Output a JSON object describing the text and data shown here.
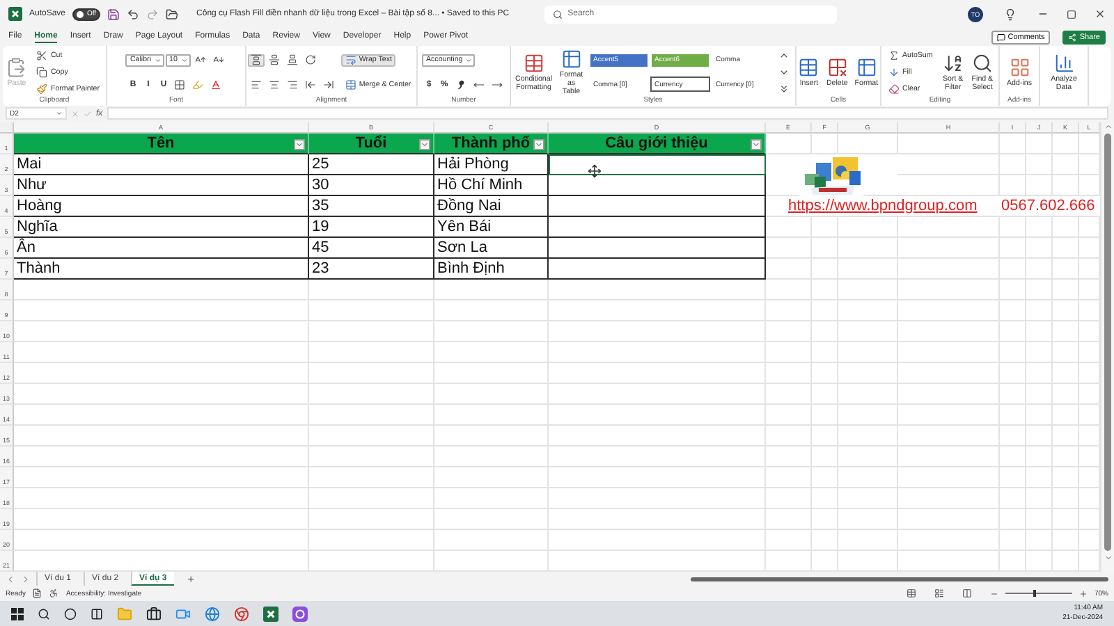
{
  "title_bar": {
    "autosave_label": "AutoSave",
    "autosave_state": "Off",
    "autosave_on": false,
    "title": "Công cụ Flash Fill điền nhanh dữ liệu trong Excel – Bài tập số 8...  •  Saved to this PC",
    "search_placeholder": "Search",
    "avatar": "TO"
  },
  "menu_tabs": [
    {
      "label": "File",
      "selected": false
    },
    {
      "label": "Home",
      "selected": true
    },
    {
      "label": "Insert",
      "selected": false
    },
    {
      "label": "Draw",
      "selected": false
    },
    {
      "label": "Page Layout",
      "selected": false
    },
    {
      "label": "Formulas",
      "selected": false
    },
    {
      "label": "Data",
      "selected": false
    },
    {
      "label": "Review",
      "selected": false
    },
    {
      "label": "View",
      "selected": false
    },
    {
      "label": "Developer",
      "selected": false
    },
    {
      "label": "Help",
      "selected": false
    },
    {
      "label": "Power Pivot",
      "selected": false
    }
  ],
  "comments": "Comments",
  "share": "Share",
  "ribbon": {
    "groups": [
      {
        "label": "Clipboard",
        "columns": [
          [
            [
              {
                "kind": "large",
                "label": "Paste",
                "disabled": true
              }
            ]
          ],
          [
            [
              {
                "kind": "small",
                "label": "Cut"
              }
            ],
            [
              {
                "kind": "small",
                "label": "Copy"
              }
            ],
            [
              {
                "kind": "small",
                "label": "Format Painter"
              }
            ]
          ]
        ]
      },
      {
        "label": "Font",
        "columns": [
          [
            [
              {
                "kind": "combo",
                "label": "Calibri"
              },
              {
                "kind": "combo",
                "label": "10"
              },
              {
                "kind": "tool"
              },
              {
                "kind": "tool"
              }
            ],
            [
              {
                "kind": "tool",
                "label": "B"
              },
              {
                "kind": "tool",
                "label": "I"
              },
              {
                "kind": "tool",
                "label": "U"
              },
              {
                "kind": "tool"
              },
              {
                "kind": "tool"
              },
              {
                "kind": "tool"
              }
            ]
          ]
        ]
      },
      {
        "label": "Alignment",
        "columns": [
          [
            [
              {
                "kind": "tool",
                "on": true
              },
              {
                "kind": "tool",
                "on": false
              },
              {
                "kind": "tool",
                "on": false
              },
              {
                "kind": "tool",
                "on": false
              }
            ],
            [
              {
                "kind": "tool",
                "on": false
              },
              {
                "kind": "tool",
                "on": false
              },
              {
                "kind": "tool",
                "on": false
              },
              {
                "kind": "tool",
                "on": false
              },
              {
                "kind": "tool",
                "on": false
              }
            ]
          ],
          [
            [
              {
                "kind": "small",
                "label": "Wrap Text",
                "on": true
              }
            ],
            [
              {
                "kind": "small",
                "label": "Merge & Center",
                "on": false
              }
            ]
          ]
        ]
      },
      {
        "label": "Number",
        "columns": [
          [
            [
              {
                "kind": "combo",
                "label": "Accounting"
              }
            ],
            [
              {
                "kind": "tool",
                "label": "$"
              },
              {
                "kind": "tool",
                "label": "%"
              },
              {
                "kind": "tool"
              },
              {
                "kind": "tool"
              },
              {
                "kind": "tool"
              }
            ]
          ]
        ]
      },
      {
        "label": "Styles",
        "columns": [
          [
            [
              {
                "kind": "large",
                "label": "Conditional Formatting"
              }
            ]
          ],
          [
            [
              {
                "kind": "large",
                "label": "Format as Table"
              }
            ]
          ],
          [
            [
              {
                "kind": "style",
                "label": "Accent5",
                "color": "#4472c4",
                "selected": false
              },
              {
                "kind": "style",
                "label": "Accent6",
                "color": "#70ad47",
                "selected": false
              },
              {
                "kind": "style",
                "label": "Comma",
                "selected": false
              }
            ],
            [
              {
                "kind": "style",
                "label": "Comma [0]",
                "selected": false
              },
              {
                "kind": "style",
                "label": "Currency",
                "selected": true
              },
              {
                "kind": "style",
                "label": "Currency [0]",
                "selected": false
              }
            ]
          ],
          [
            [
              {
                "kind": "tool"
              }
            ],
            [
              {
                "kind": "tool"
              }
            ],
            [
              {
                "kind": "tool"
              }
            ]
          ]
        ]
      },
      {
        "label": "Cells",
        "columns": [
          [
            [
              {
                "kind": "large",
                "label": "Insert"
              }
            ]
          ],
          [
            [
              {
                "kind": "large",
                "label": "Delete"
              }
            ]
          ],
          [
            [
              {
                "kind": "large",
                "label": "Format"
              }
            ]
          ]
        ]
      },
      {
        "label": "Editing",
        "columns": [
          [
            [
              {
                "kind": "small",
                "label": "AutoSum"
              }
            ],
            [
              {
                "kind": "small",
                "label": "Fill"
              }
            ],
            [
              {
                "kind": "small",
                "label": "Clear"
              }
            ]
          ],
          [
            [
              {
                "kind": "large",
                "label": "Sort & Filter"
              }
            ]
          ],
          [
            [
              {
                "kind": "large",
                "label": "Find & Select"
              }
            ]
          ]
        ]
      },
      {
        "label": "Add-ins",
        "columns": [
          [
            [
              {
                "kind": "large",
                "label": "Add-ins"
              }
            ]
          ]
        ]
      },
      {
        "columns": [
          [
            [
              {
                "kind": "large",
                "label": "Analyze Data"
              }
            ]
          ]
        ]
      }
    ]
  },
  "formula_bar": {
    "name_box": "D2",
    "fx": "fx"
  },
  "columns": [
    "A",
    "B",
    "C",
    "D",
    "E",
    "F",
    "G",
    "H",
    "I",
    "J",
    "K",
    "L"
  ],
  "row_numbers": [
    "1",
    "2",
    "3",
    "4",
    "5",
    "6",
    "7",
    "8",
    "9",
    "10",
    "11",
    "12",
    "13",
    "14",
    "15",
    "16",
    "17",
    "18",
    "19",
    "20",
    "21"
  ],
  "table": {
    "header": [
      "Tên",
      "Tuổi",
      "Thành phố",
      "Câu giới thiệu"
    ],
    "rows": [
      {
        "cells": [
          "Mai",
          "25",
          "Hải Phòng"
        ],
        "selected": true
      },
      {
        "cells": [
          "Như",
          "30",
          "Hồ Chí Minh"
        ],
        "selected": false
      },
      {
        "cells": [
          "Hoàng",
          "35",
          "Đồng Nai"
        ],
        "selected": false
      },
      {
        "cells": [
          "Nghĩa",
          "19",
          "Yên Bái"
        ],
        "selected": false
      },
      {
        "cells": [
          "Ân",
          "45",
          "Sơn La"
        ],
        "selected": false
      },
      {
        "cells": [
          "Thành",
          "23",
          "Bình Định"
        ],
        "selected": false
      }
    ]
  },
  "link": "https://www.bpndgroup.com",
  "phone": "0567.602.666",
  "sheet_tabs": [
    {
      "label": "Ví du 1",
      "selected": false
    },
    {
      "label": "Ví du 2",
      "selected": false
    },
    {
      "label": "Ví dụ 3",
      "selected": true
    }
  ],
  "add_sheet": "+",
  "status_bar": {
    "ready": "Ready",
    "accessibility": "Accessibility: Investigate",
    "zoom": "70%",
    "zoom_slider": {
      "level": 0.42
    }
  },
  "clock": {
    "time": "11:40 AM",
    "date": "21-Dec-2024"
  }
}
